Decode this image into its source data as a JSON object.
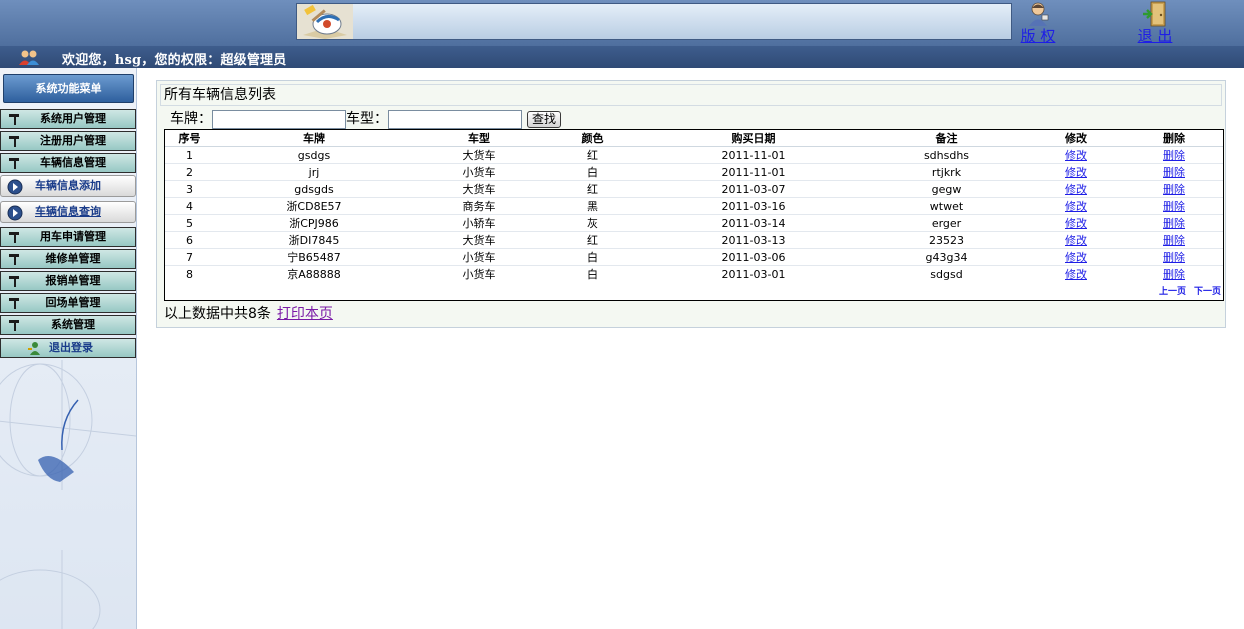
{
  "header": {
    "copyright_label": "版 权",
    "logout_label": "退 出"
  },
  "welcome": {
    "text": "欢迎您，hsg，您的权限：超级管理员"
  },
  "sidebar": {
    "header_label": "系统功能菜单",
    "items": [
      {
        "label": "系统用户管理"
      },
      {
        "label": "注册用户管理"
      },
      {
        "label": "车辆信息管理"
      },
      {
        "label": "车辆信息添加"
      },
      {
        "label": "车辆信息查询"
      },
      {
        "label": "用车申请管理"
      },
      {
        "label": "维修单管理"
      },
      {
        "label": "报销单管理"
      },
      {
        "label": "回场单管理"
      },
      {
        "label": "系统管理"
      }
    ],
    "logout_label": "退出登录"
  },
  "main": {
    "title": "所有车辆信息列表",
    "search": {
      "plate_label": "车牌：",
      "plate_value": "",
      "type_label": "车型：",
      "type_value": "",
      "button_label": "查找"
    },
    "table": {
      "columns": [
        "序号",
        "车牌",
        "车型",
        "颜色",
        "购买日期",
        "备注",
        "修改",
        "删除"
      ],
      "rows": [
        [
          "1",
          "gsdgs",
          "大货车",
          "红",
          "2011-11-01",
          "sdhsdhs",
          "修改",
          "删除"
        ],
        [
          "2",
          "jrj",
          "小货车",
          "白",
          "2011-11-01",
          "rtjkrk",
          "修改",
          "删除"
        ],
        [
          "3",
          "gdsgds",
          "大货车",
          "红",
          "2011-03-07",
          "gegw",
          "修改",
          "删除"
        ],
        [
          "4",
          "浙CD8E57",
          "商务车",
          "黑",
          "2011-03-16",
          "wtwet",
          "修改",
          "删除"
        ],
        [
          "5",
          "浙CPJ986",
          "小轿车",
          "灰",
          "2011-03-14",
          "erger",
          "修改",
          "删除"
        ],
        [
          "6",
          "浙DI7845",
          "大货车",
          "红",
          "2011-03-13",
          "23523",
          "修改",
          "删除"
        ],
        [
          "7",
          "宁B65487",
          "小货车",
          "白",
          "2011-03-06",
          "g43g34",
          "修改",
          "删除"
        ],
        [
          "8",
          "京A88888",
          "小货车",
          "白",
          "2011-03-01",
          "sdgsd",
          "修改",
          "删除"
        ]
      ]
    },
    "pager": {
      "prev_label": "上一页",
      "next_label": "下一页"
    },
    "footer": {
      "summary": "以上数据中共8条",
      "print_label": "打印本页"
    }
  }
}
